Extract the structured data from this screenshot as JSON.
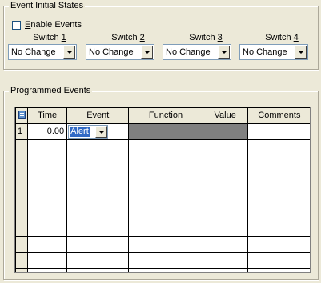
{
  "event_initial_states": {
    "title": "Event Initial States",
    "enable_events": {
      "label_pre": "",
      "label_accel": "E",
      "label_post": "nable Events",
      "checked": false
    },
    "switches": [
      {
        "label_pre": "Switch ",
        "label_accel": "1",
        "value": "No Change"
      },
      {
        "label_pre": "Switch ",
        "label_accel": "2",
        "value": "No Change"
      },
      {
        "label_pre": "Switch ",
        "label_accel": "3",
        "value": "No Change"
      },
      {
        "label_pre": "Switch ",
        "label_accel": "4",
        "value": "No Change"
      }
    ]
  },
  "programmed_events": {
    "title": "Programmed Events",
    "columns": [
      "Time",
      "Event",
      "Function",
      "Value",
      "Comments"
    ],
    "corner_icon": "grid-icon",
    "rows": [
      {
        "num": "1",
        "time": "0.00",
        "event": "Alert",
        "function": "",
        "value": "",
        "comments": ""
      }
    ],
    "empty_rows": 9
  }
}
